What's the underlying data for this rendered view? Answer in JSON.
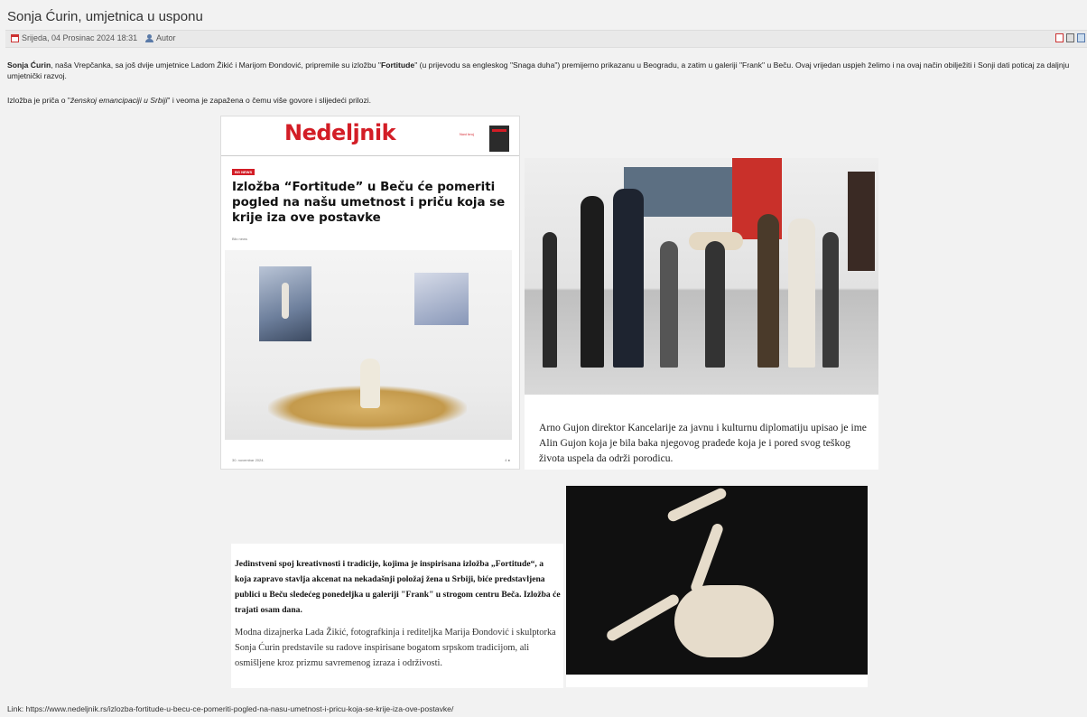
{
  "article": {
    "title": "Sonja Ćurin, umjetnica u usponu",
    "date": "Srijeda, 04 Prosinac 2024 18:31",
    "author": "Autor"
  },
  "body": {
    "p1_bold_name": "Sonja Ćurin",
    "p1_part1": ", naša Vrepčanka, sa još dvije umjetnice Ladom Žikić i Marijom Đondović, pripremile su izložbu \"",
    "p1_bold_title": "Fortitude",
    "p1_part2": "\" (u prijevodu sa engleskog \"Snaga duha\") premijerno prikazanu u Beogradu, a zatim u galeriji \"Frank\" u Beču. Ovaj vrijedan uspjeh želimo i na ovaj način obilježiti i Sonji dati poticaj za daljnju umjetnički razvoj.",
    "p2_part1": "Izložba je priča o \"",
    "p2_italic": "ženskoj emancipaciji u Srbiji",
    "p2_part2": "\" i veoma je zapažena o čemu više govore i slijedeći prilozi."
  },
  "clipping1": {
    "brand": "Nedeljnik",
    "sub_tag": "Novi broj",
    "kicker": "BG NEWS",
    "headline": "Izložba “Fortitude” u Beču će pomeriti pogled na našu umetnost i priču koja se krije iza ove postavke",
    "byline": "Blic news",
    "footer_date": "30. novembar 2024.",
    "footer_page": "4 ●"
  },
  "clipping2": {
    "caption": "Arno Gujon direktor Kancelarije za javnu i kulturnu diplomatiju upisao je ime Alin Gujon koja je bila baka njegovog pradede koja je i pored svog teškog života uspela da održi porodicu."
  },
  "clipping4": {
    "bold_text": "Jedinstveni spoj kreativnosti i tradicije, kojima je inspirisana izložba „Fortitude“, a koja zapravo stavlja akcenat na nekadašnji položaj žena u Srbiji, biće predstavljena publici u Beču sledećeg ponedeljka u galeriji \"Frank\" u strogom centru Beča. Izložba će trajati osam dana.",
    "regular_text": "Modna dizajnerka Lada Žikić, fotografkinja i rediteljka Marija Đondović i skulptorka Sonja Ćurin predstavile su radove inspirisane bogatom srpskom tradicijom, ali osmišljene kroz prizmu savremenog izraza i održivosti."
  },
  "link": {
    "label": "Link: ",
    "url": "https://www.nedeljnik.rs/izlozba-fortitude-u-becu-ce-pomeriti-pogled-na-nasu-umetnost-i-pricu-koja-se-krije-iza-ove-postavke/"
  },
  "icons": [
    "calendar-icon",
    "user-icon",
    "pdf-icon",
    "print-icon",
    "email-icon"
  ],
  "colors": {
    "brand_red": "#d31d26",
    "meta_bar": "#e9e9e9"
  }
}
